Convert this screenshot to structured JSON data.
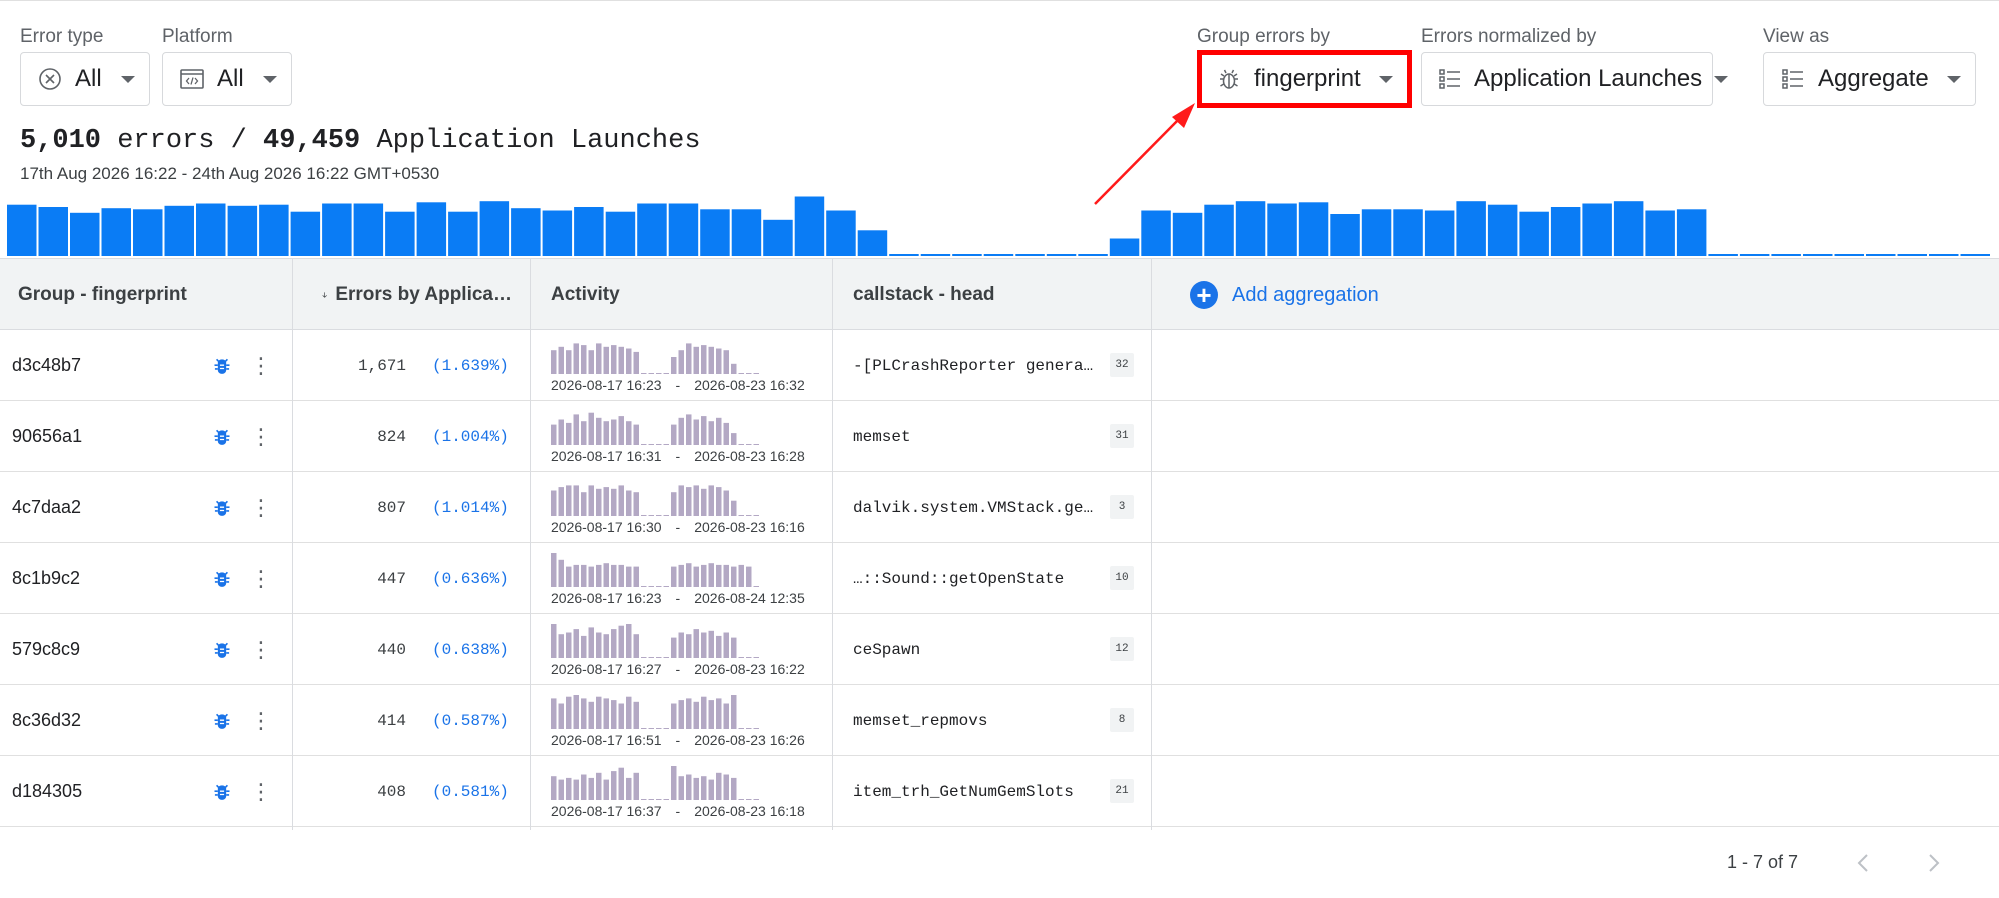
{
  "filters": {
    "error_type": {
      "label": "Error type",
      "value": "All",
      "icon": "error-circle-icon"
    },
    "platform": {
      "label": "Platform",
      "value": "All",
      "icon": "code-window-icon"
    },
    "group_by": {
      "label": "Group errors by",
      "value": "fingerprint",
      "icon": "bug-outline-icon"
    },
    "normalized_by": {
      "label": "Errors normalized by",
      "value": "Application Launches",
      "icon": "list-icon"
    },
    "view_as": {
      "label": "View as",
      "value": "Aggregate",
      "icon": "list-icon"
    }
  },
  "summary": {
    "errors_count": "5,010",
    "errors_word": "errors /",
    "launches_count": "49,459",
    "launches_word": "Application Launches",
    "date_range": "17th Aug 2026 16:22 - 24th Aug 2026 16:22 GMT+0530"
  },
  "histogram": {
    "color": "#0a7cf5",
    "values": [
      44,
      42,
      37,
      41,
      40,
      43,
      45,
      43,
      44,
      38,
      45,
      45,
      38,
      46,
      38,
      47,
      41,
      39,
      42,
      38,
      45,
      45,
      40,
      40,
      31,
      51,
      39,
      22,
      0,
      0,
      0,
      0,
      0,
      0,
      0,
      15,
      39,
      37,
      44,
      47,
      45,
      46,
      36,
      40,
      40,
      39,
      47,
      44,
      38,
      42,
      45,
      47,
      39,
      40,
      0,
      0,
      0,
      0,
      0,
      0,
      0,
      0,
      0
    ]
  },
  "table": {
    "headers": {
      "group": "Group - fingerprint",
      "errors": "Errors by Applica…",
      "activity": "Activity",
      "callstack": "callstack - head",
      "add_aggregation": "Add aggregation"
    },
    "rows": [
      {
        "fingerprint": "d3c48b7",
        "count": "1,671",
        "pct": "(1.639%)",
        "start": "2026-08-17 16:23",
        "end": "2026-08-23 16:32",
        "callstack": "-[PLCrashReporter genera…",
        "frames": "32",
        "spark": [
          14,
          16,
          14,
          18,
          17,
          14,
          18,
          16,
          17,
          16,
          15,
          13,
          0,
          0,
          0,
          0,
          10,
          14,
          18,
          16,
          17,
          16,
          15,
          14,
          6,
          0,
          0,
          0
        ]
      },
      {
        "fingerprint": "90656a1",
        "count": "824",
        "pct": "(1.004%)",
        "start": "2026-08-17 16:31",
        "end": "2026-08-23 16:28",
        "callstack": "memset",
        "frames": "31",
        "spark": [
          12,
          15,
          13,
          18,
          14,
          19,
          16,
          14,
          15,
          17,
          14,
          12,
          0,
          0,
          0,
          0,
          12,
          16,
          18,
          15,
          17,
          14,
          16,
          13,
          7,
          0,
          0,
          0
        ]
      },
      {
        "fingerprint": "4c7daa2",
        "count": "807",
        "pct": "(1.014%)",
        "start": "2026-08-17 16:30",
        "end": "2026-08-23 16:16",
        "callstack": "dalvik.system.VMStack.ge…",
        "frames": "3",
        "spark": [
          15,
          17,
          18,
          18,
          14,
          18,
          16,
          17,
          16,
          18,
          15,
          14,
          0,
          0,
          0,
          0,
          14,
          18,
          17,
          18,
          16,
          18,
          17,
          15,
          9,
          0,
          0,
          0
        ]
      },
      {
        "fingerprint": "8c1b9c2",
        "count": "447",
        "pct": "(0.636%)",
        "start": "2026-08-17 16:23",
        "end": "2026-08-24 12:35",
        "callstack": "…::Sound::getOpenState",
        "frames": "10",
        "spark": [
          20,
          16,
          12,
          13,
          13,
          12,
          13,
          14,
          13,
          13,
          12,
          12,
          0,
          0,
          0,
          0,
          12,
          13,
          14,
          12,
          13,
          14,
          13,
          13,
          12,
          13,
          12,
          0
        ]
      },
      {
        "fingerprint": "579c8c9",
        "count": "440",
        "pct": "(0.638%)",
        "start": "2026-08-17 16:27",
        "end": "2026-08-23 16:22",
        "callstack": "ceSpawn",
        "frames": "12",
        "spark": [
          20,
          14,
          15,
          17,
          13,
          18,
          15,
          14,
          17,
          19,
          20,
          14,
          0,
          0,
          0,
          0,
          12,
          15,
          14,
          17,
          15,
          16,
          13,
          15,
          12,
          0,
          0,
          0
        ]
      },
      {
        "fingerprint": "8c36d32",
        "count": "414",
        "pct": "(0.587%)",
        "start": "2026-08-17 16:51",
        "end": "2026-08-23 16:26",
        "callstack": "memset_repmovs",
        "frames": "8",
        "spark": [
          18,
          15,
          19,
          20,
          18,
          16,
          19,
          18,
          17,
          15,
          19,
          16,
          0,
          0,
          0,
          0,
          15,
          17,
          18,
          16,
          19,
          17,
          18,
          15,
          20,
          0,
          0,
          0
        ]
      },
      {
        "fingerprint": "d184305",
        "count": "408",
        "pct": "(0.581%)",
        "start": "2026-08-17 16:37",
        "end": "2026-08-23 16:18",
        "callstack": "item_trh_GetNumGemSlots",
        "frames": "21",
        "spark": [
          14,
          12,
          13,
          12,
          15,
          13,
          16,
          12,
          17,
          19,
          13,
          16,
          0,
          0,
          0,
          0,
          20,
          14,
          15,
          13,
          14,
          12,
          16,
          15,
          13,
          0,
          0,
          0
        ]
      }
    ]
  },
  "pagination": {
    "text": "1 - 7 of 7"
  },
  "colors": {
    "accent": "#1a73e8",
    "spark": "#b3a8c4",
    "highlight": "#ff0000",
    "histogram": "#0a7cf5"
  }
}
